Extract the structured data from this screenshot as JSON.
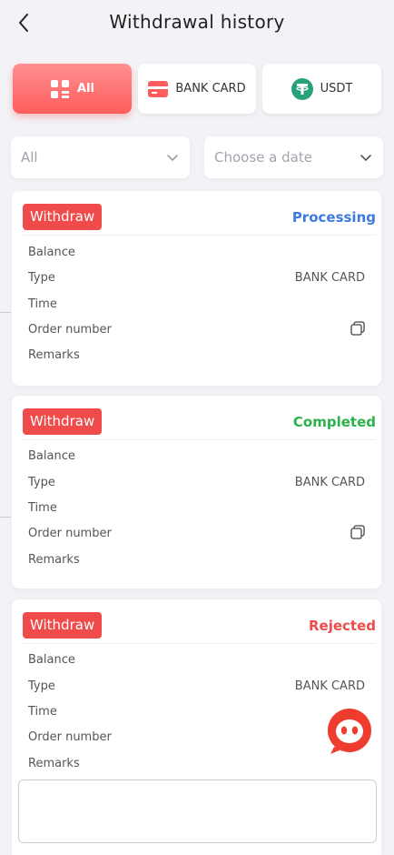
{
  "header": {
    "title": "Withdrawal history"
  },
  "tabs": [
    {
      "label": "All",
      "icon": "grid-list-icon",
      "active": true
    },
    {
      "label": "BANK CARD",
      "icon": "bank-card-icon",
      "active": false
    },
    {
      "label": "USDT",
      "icon": "tether-icon",
      "active": false
    }
  ],
  "filters": {
    "type": "All",
    "date_placeholder": "Choose a date"
  },
  "records": [
    {
      "badge": "Withdraw",
      "status": "Processing",
      "status_color": "#3d7be0",
      "rows": {
        "balance": "Balance",
        "type": "Type",
        "type_value": "BANK CARD",
        "time": "Time",
        "order": "Order number",
        "remarks": "Remarks"
      }
    },
    {
      "badge": "Withdraw",
      "status": "Completed",
      "status_color": "#2bb24c",
      "rows": {
        "balance": "Balance",
        "type": "Type",
        "type_value": "BANK CARD",
        "time": "Time",
        "order": "Order number",
        "remarks": "Remarks"
      }
    },
    {
      "badge": "Withdraw",
      "status": "Rejected",
      "status_color": "#ee4b4b",
      "rows": {
        "balance": "Balance",
        "type": "Type",
        "type_value": "BANK CARD",
        "time": "Time",
        "order": "Order number",
        "remarks": "Remarks"
      }
    }
  ],
  "colors": {
    "accent": "#ff5d5d",
    "badge": "#f04b4b",
    "usdt": "#26a17b"
  },
  "floating": {
    "icon": "customer-service-icon"
  }
}
